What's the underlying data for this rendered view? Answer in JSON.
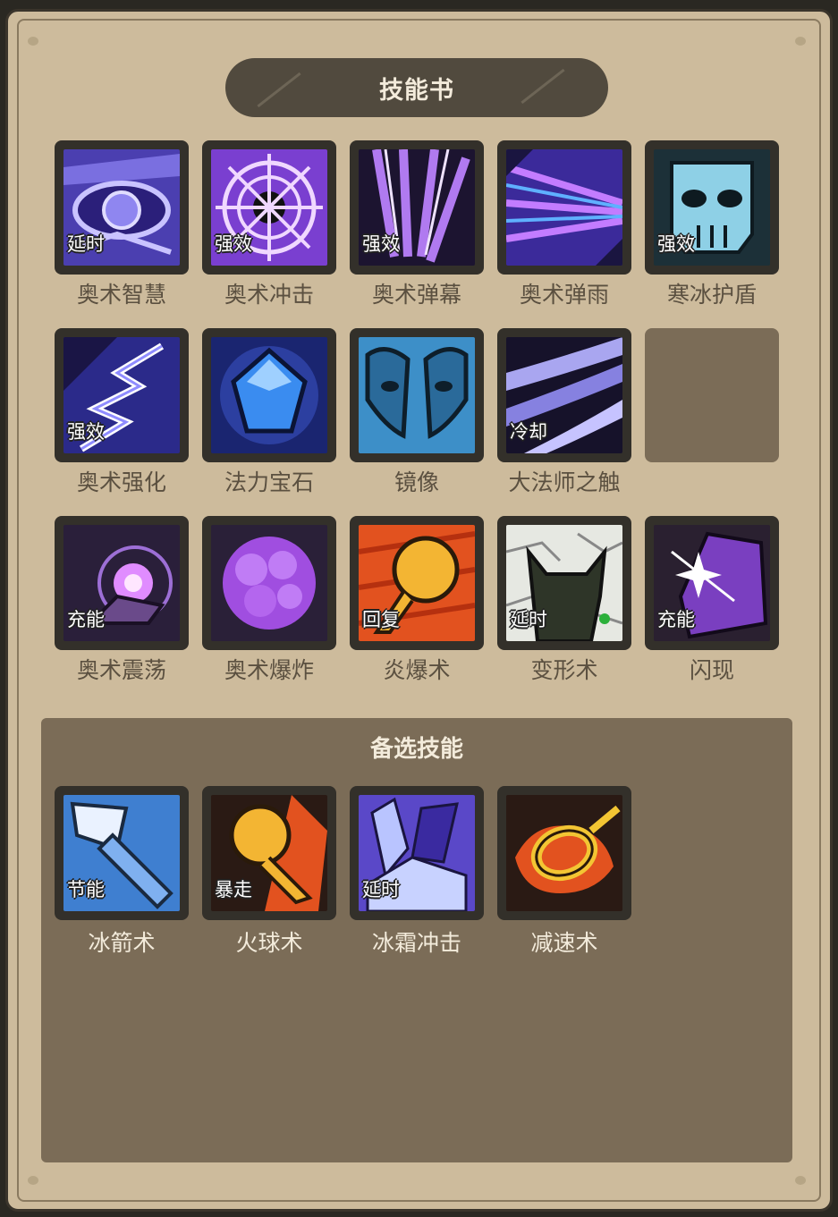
{
  "title": "技能书",
  "alt_title": "备选技能",
  "colors": {
    "parchment": "#cdbb9c",
    "banner": "#514a3e",
    "alt_panel": "#7b6c57",
    "slot_border": "#33302a"
  },
  "skills": [
    {
      "name": "奥术智慧",
      "badge": "延时",
      "icon": "arcane-eye-icon"
    },
    {
      "name": "奥术冲击",
      "badge": "强效",
      "icon": "arcane-web-icon"
    },
    {
      "name": "奥术弹幕",
      "badge": "强效",
      "icon": "arcane-streaks-icon"
    },
    {
      "name": "奥术弹雨",
      "badge": "",
      "icon": "arcane-rain-icon"
    },
    {
      "name": "寒冰护盾",
      "badge": "强效",
      "icon": "ice-skull-icon"
    },
    {
      "name": "奥术强化",
      "badge": "强效",
      "icon": "lightning-icon"
    },
    {
      "name": "法力宝石",
      "badge": "",
      "icon": "mana-gem-icon"
    },
    {
      "name": "镜像",
      "badge": "",
      "icon": "mirror-mask-icon"
    },
    {
      "name": "大法师之触",
      "badge": "冷却",
      "icon": "claw-slash-icon"
    },
    {
      "name": "奥术震荡",
      "badge": "充能",
      "icon": "arcane-orb-hand-icon"
    },
    {
      "name": "奥术爆炸",
      "badge": "",
      "icon": "arcane-explosion-icon"
    },
    {
      "name": "炎爆术",
      "badge": "回复",
      "icon": "pyroblast-icon"
    },
    {
      "name": "变形术",
      "badge": "延时",
      "icon": "polymorph-cat-icon"
    },
    {
      "name": "闪现",
      "badge": "充能",
      "icon": "blink-icon"
    }
  ],
  "alt_skills": [
    {
      "name": "冰箭术",
      "badge": "节能",
      "icon": "frostbolt-icon"
    },
    {
      "name": "火球术",
      "badge": "暴走",
      "icon": "fireball-icon"
    },
    {
      "name": "冰霜冲击",
      "badge": "延时",
      "icon": "frost-nova-icon"
    },
    {
      "name": "减速术",
      "badge": "",
      "icon": "slow-chain-icon"
    }
  ]
}
